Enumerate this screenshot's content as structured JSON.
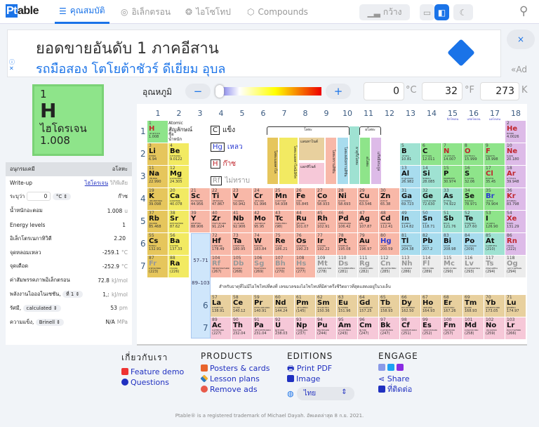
{
  "header": {
    "logo_a": "Pt",
    "logo_b": "able",
    "tabs": [
      {
        "label": "คุณสมบัติ",
        "icon": "list-icon"
      },
      {
        "label": "อิเล็กตรอน",
        "icon": "atom-icon"
      },
      {
        "label": "ไอโซโทป",
        "icon": "nucleus-icon"
      },
      {
        "label": "Compounds",
        "icon": "molecule-icon"
      }
    ],
    "wide_label": "กว้าง",
    "accent": "#1a73e8"
  },
  "ad": {
    "headline": "ยอดขายอันดับ 1 ภาคอีสาน",
    "subline": "รถมือสอง โตโยต้าชัวร์ ดีเยี่ยม อุบล",
    "close": "×",
    "label": "«Ad"
  },
  "selected": {
    "number": "1",
    "symbol": "H",
    "name": "ไฮโดรเจน",
    "mass": "1.008"
  },
  "temperature": {
    "label": "อุณหภูมิ",
    "minus": "−",
    "plus": "+",
    "celsius": "0",
    "celsius_unit": "°C",
    "fahrenheit": "32",
    "fahrenheit_unit": "°F",
    "kelvin": "273",
    "kelvin_unit": "K",
    "slider_fraction": 0.02
  },
  "properties": {
    "series_label": "อนุกรมเคมี",
    "series_value": "อโลหะ",
    "writeup_label": "Write-up",
    "writeup_link": "ไฮโดรเจน",
    "writeup_wiki": "วิกิพีเดีย",
    "state_label": "ระบุว่า",
    "state_temp": "0",
    "state_unit": "°C ⇕",
    "state_value": "ก๊าซ",
    "rows": [
      {
        "label": "น้ำหนักอะตอม",
        "value": "1.008",
        "unit": "u"
      },
      {
        "label": "Energy levels",
        "value": "1",
        "unit": ""
      },
      {
        "label": "อิเล็กโตรเนกาทิวิตี",
        "value": "2.20",
        "unit": ""
      },
      {
        "label": "จุดหลอมเหลว",
        "value": "-259.1",
        "unit": "°C"
      },
      {
        "label": "จุดเดือด",
        "value": "-252.9",
        "unit": "°C"
      },
      {
        "label": "ค่าสัมพรรคภาพอิเล็กตรอน",
        "value": "72.8",
        "unit": "kJ/mol"
      }
    ],
    "ion_label": "พลังงานไอออไนเซชัน,",
    "ion_select": "ที่ 1  ⇕",
    "ion_value": "1,:",
    "ion_unit": "kJ/mol",
    "radius_label": "รัศมี,",
    "radius_select": "calculated   ⇕",
    "radius_value": "53",
    "radius_unit": "pm",
    "hard_label": "ความแข็ง,",
    "hard_select": "Brinell ⇕",
    "hard_value": "N/A",
    "hard_unit": "MPa"
  },
  "table": {
    "groups": [
      "1",
      "2",
      "3",
      "4",
      "5",
      "6",
      "7",
      "8",
      "9",
      "10",
      "11",
      "12",
      "13",
      "14",
      "15",
      "16",
      "17",
      "18"
    ],
    "group_subtitles": {
      "15": "นิกโทเจน",
      "16": "แชลโคเจน",
      "17": "แฮโลเจน"
    },
    "periods": [
      "1",
      "2",
      "3",
      "4",
      "5",
      "6",
      "7"
    ],
    "f_periods": [
      "6",
      "7"
    ],
    "lan_range": "57–71",
    "act_range": "89–103",
    "key": {
      "atomic": "Atomic",
      "symbol": "สัญลักษณ์",
      "name": "ชื่อ",
      "weight": "น้ำหนัก"
    },
    "states": [
      {
        "sym": "C",
        "label": "แข็ง",
        "color": "#222"
      },
      {
        "sym": "Hg",
        "label": "เหลว",
        "color": "#2a3ad0"
      },
      {
        "sym": "H",
        "label": "ก๊าซ",
        "color": "#c0262d"
      },
      {
        "sym": "Rf",
        "label": "ไม่ทราบ",
        "color": "#999"
      }
    ],
    "metal_label": "โลหะ",
    "nonmetal_label": "อโลหะ",
    "categories": {
      "al": {
        "label": "โลหะแอลคาไล",
        "color": "#e6c65c"
      },
      "ae": {
        "label": "โลหะแอลคาไลน์เอิร์ท",
        "color": "#f2ea62"
      },
      "la": {
        "label": "แลนทาไนด์",
        "color": "#e8d09e"
      },
      "ac": {
        "label": "แอกทิไนด์",
        "color": "#f6c8d8"
      },
      "tm": {
        "label": "โลหะทรานสิชัน",
        "color": "#f8b8a8"
      },
      "pt": {
        "label": "โลหะหลังทรานสิชัน",
        "color": "#a8dcee"
      },
      "md": {
        "label": "ธาตุกึ่งโลหะ",
        "color": "#9fe2d2"
      },
      "nm": {
        "label": "อโลหะ",
        "color": "#8ee48a"
      },
      "ng": {
        "label": "แก๊สมีตระกูล",
        "color": "#ddbbe8"
      },
      "uk": {
        "label": "",
        "color": "#ececec"
      }
    },
    "note": "สำหรับธาตุที่ไม่มีไอโซโทปที่คงที่ เลขมวลของไอโซโทปที่มีค่าครึ่งชีวิตยาวที่สุดแสดงอยู่ในวงเล็บ",
    "elements": [
      [
        1,
        "H",
        "ไฮโดรเจน",
        "1.008",
        "nm",
        "g"
      ],
      [
        2,
        "He",
        "ฮีเลียม",
        "4.0026",
        "ng",
        "g"
      ],
      [
        3,
        "Li",
        "ลิเทียม",
        "6.94",
        "al",
        "s"
      ],
      [
        4,
        "Be",
        "เบริลเลียม",
        "9.0122",
        "ae",
        "s"
      ],
      [
        5,
        "B",
        "โบรอน",
        "10.81",
        "md",
        "s"
      ],
      [
        6,
        "C",
        "คาร์บอน",
        "12.011",
        "nm",
        "s"
      ],
      [
        7,
        "N",
        "ไนโตรเจน",
        "14.007",
        "nm",
        "g"
      ],
      [
        8,
        "O",
        "ออกซิเจน",
        "15.999",
        "nm",
        "g"
      ],
      [
        9,
        "F",
        "ฟลูออรีน",
        "18.998",
        "nm",
        "g"
      ],
      [
        10,
        "Ne",
        "นีออน",
        "20.180",
        "ng",
        "g"
      ],
      [
        11,
        "Na",
        "โซเดียม",
        "22.990",
        "al",
        "s"
      ],
      [
        12,
        "Mg",
        "แมกนีเซียม",
        "24.305",
        "ae",
        "s"
      ],
      [
        13,
        "Al",
        "อะลูมิเนียม",
        "26.982",
        "pt",
        "s"
      ],
      [
        14,
        "Si",
        "ซิลิคอน",
        "28.085",
        "md",
        "s"
      ],
      [
        15,
        "P",
        "ฟอสฟอรัส",
        "30.974",
        "nm",
        "s"
      ],
      [
        16,
        "S",
        "กำมะถัน",
        "32.06",
        "nm",
        "s"
      ],
      [
        17,
        "Cl",
        "คลอรีน",
        "35.45",
        "nm",
        "g"
      ],
      [
        18,
        "Ar",
        "อาร์กอน",
        "39.948",
        "ng",
        "g"
      ],
      [
        19,
        "K",
        "โพแทสเซียม",
        "39.098",
        "al",
        "s"
      ],
      [
        20,
        "Ca",
        "แคลเซียม",
        "40.078",
        "ae",
        "s"
      ],
      [
        21,
        "Sc",
        "สแกนเดียม",
        "44.956",
        "tm",
        "s"
      ],
      [
        22,
        "Ti",
        "ไทเทเนียม",
        "47.867",
        "tm",
        "s"
      ],
      [
        23,
        "V",
        "วาเนเดียม",
        "50.942",
        "tm",
        "s"
      ],
      [
        24,
        "Cr",
        "โครเมียม",
        "51.996",
        "tm",
        "s"
      ],
      [
        25,
        "Mn",
        "แมงกานีส",
        "54.938",
        "tm",
        "s"
      ],
      [
        26,
        "Fe",
        "เหล็ก",
        "55.845",
        "tm",
        "s"
      ],
      [
        27,
        "Co",
        "โคบอลต์",
        "58.933",
        "tm",
        "s"
      ],
      [
        28,
        "Ni",
        "นิกเกิล",
        "58.693",
        "tm",
        "s"
      ],
      [
        29,
        "Cu",
        "ทองแดง",
        "63.546",
        "tm",
        "s"
      ],
      [
        30,
        "Zn",
        "สังกะสี",
        "65.38",
        "tm",
        "s"
      ],
      [
        31,
        "Ga",
        "แกลเลียม",
        "69.723",
        "pt",
        "s"
      ],
      [
        32,
        "Ge",
        "เจอร์เมเนียม",
        "72.630",
        "md",
        "s"
      ],
      [
        33,
        "As",
        "สารหนู",
        "74.922",
        "md",
        "s"
      ],
      [
        34,
        "Se",
        "ซีลีเนียม",
        "78.971",
        "nm",
        "s"
      ],
      [
        35,
        "Br",
        "โบรมีน",
        "79.904",
        "nm",
        "l"
      ],
      [
        36,
        "Kr",
        "คริปทอน",
        "83.798",
        "ng",
        "g"
      ],
      [
        37,
        "Rb",
        "รูบิเดียม",
        "85.468",
        "al",
        "s"
      ],
      [
        38,
        "Sr",
        "สตรอนเซียม",
        "87.62",
        "ae",
        "s"
      ],
      [
        39,
        "Y",
        "อิตเทรียม",
        "88.906",
        "tm",
        "s"
      ],
      [
        40,
        "Zr",
        "เซอร์โคเนียม",
        "91.224",
        "tm",
        "s"
      ],
      [
        41,
        "Nb",
        "ไนโอเบียม",
        "92.906",
        "tm",
        "s"
      ],
      [
        42,
        "Mo",
        "โมลิบดีนัม",
        "95.95",
        "tm",
        "s"
      ],
      [
        43,
        "Tc",
        "เทคนีเชียม",
        "(98)",
        "tm",
        "s"
      ],
      [
        44,
        "Ru",
        "รูทีเนียม",
        "101.07",
        "tm",
        "s"
      ],
      [
        45,
        "Rh",
        "โรเดียม",
        "102.91",
        "tm",
        "s"
      ],
      [
        46,
        "Pd",
        "แพลเลเดียม",
        "106.42",
        "tm",
        "s"
      ],
      [
        47,
        "Ag",
        "เงิน",
        "107.87",
        "tm",
        "s"
      ],
      [
        48,
        "Cd",
        "แคดเมียม",
        "112.41",
        "tm",
        "s"
      ],
      [
        49,
        "In",
        "อินเดียม",
        "114.82",
        "pt",
        "s"
      ],
      [
        50,
        "Sn",
        "ดีบุก",
        "118.71",
        "pt",
        "s"
      ],
      [
        51,
        "Sb",
        "พลวง",
        "121.76",
        "md",
        "s"
      ],
      [
        52,
        "Te",
        "เทลลูเรียม",
        "127.60",
        "md",
        "s"
      ],
      [
        53,
        "I",
        "ไอโอดีน",
        "126.90",
        "nm",
        "s"
      ],
      [
        54,
        "Xe",
        "ซีนอน",
        "131.29",
        "ng",
        "g"
      ],
      [
        55,
        "Cs",
        "ซีเซียม",
        "132.91",
        "al",
        "s"
      ],
      [
        56,
        "Ba",
        "แบเรียม",
        "137.33",
        "ae",
        "s"
      ],
      [
        57,
        "La",
        "แลนทานัม",
        "138.91",
        "la",
        "s"
      ],
      [
        58,
        "Ce",
        "ซีเรียม",
        "140.12",
        "la",
        "s"
      ],
      [
        59,
        "Pr",
        "เพรซีโอดิเมียม",
        "140.91",
        "la",
        "s"
      ],
      [
        60,
        "Nd",
        "นีโอดิเมียม",
        "144.24",
        "la",
        "s"
      ],
      [
        61,
        "Pm",
        "โพรมีเทียม",
        "(145)",
        "la",
        "s"
      ],
      [
        62,
        "Sm",
        "ซาแมเรียม",
        "150.36",
        "la",
        "s"
      ],
      [
        63,
        "Eu",
        "ยูโรเพียม",
        "151.96",
        "la",
        "s"
      ],
      [
        64,
        "Gd",
        "แกโดลิเนียม",
        "157.25",
        "la",
        "s"
      ],
      [
        65,
        "Tb",
        "เทอร์เบียม",
        "158.93",
        "la",
        "s"
      ],
      [
        66,
        "Dy",
        "ดิสโพรเซียม",
        "162.50",
        "la",
        "s"
      ],
      [
        67,
        "Ho",
        "โฮลเมียม",
        "164.93",
        "la",
        "s"
      ],
      [
        68,
        "Er",
        "เออร์เบียม",
        "167.26",
        "la",
        "s"
      ],
      [
        69,
        "Tm",
        "ทูเลียม",
        "168.93",
        "la",
        "s"
      ],
      [
        70,
        "Yb",
        "อิตเทอร์เบียม",
        "173.05",
        "la",
        "s"
      ],
      [
        71,
        "Lu",
        "ลูทีเทียม",
        "174.97",
        "la",
        "s"
      ],
      [
        72,
        "Hf",
        "แฮฟเนียม",
        "178.49",
        "tm",
        "s"
      ],
      [
        73,
        "Ta",
        "แทนทาลัม",
        "180.95",
        "tm",
        "s"
      ],
      [
        74,
        "W",
        "ทังสเตน",
        "183.84",
        "tm",
        "s"
      ],
      [
        75,
        "Re",
        "รีเนียม",
        "186.21",
        "tm",
        "s"
      ],
      [
        76,
        "Os",
        "ออสเมียม",
        "190.23",
        "tm",
        "s"
      ],
      [
        77,
        "Ir",
        "อิริเดียม",
        "192.22",
        "tm",
        "s"
      ],
      [
        78,
        "Pt",
        "แพลทินัม",
        "195.08",
        "tm",
        "s"
      ],
      [
        79,
        "Au",
        "ทองคำ",
        "196.97",
        "tm",
        "s"
      ],
      [
        80,
        "Hg",
        "ปรอท",
        "200.59",
        "tm",
        "l"
      ],
      [
        81,
        "Tl",
        "แทลเลียม",
        "204.38",
        "pt",
        "s"
      ],
      [
        82,
        "Pb",
        "ตะกั่ว",
        "207.2",
        "pt",
        "s"
      ],
      [
        83,
        "Bi",
        "บิสมัท",
        "208.98",
        "pt",
        "s"
      ],
      [
        84,
        "Po",
        "พอโลเนียม",
        "(209)",
        "pt",
        "s"
      ],
      [
        85,
        "At",
        "แอสทาทีน",
        "(210)",
        "md",
        "s"
      ],
      [
        86,
        "Rn",
        "เรดอน",
        "(222)",
        "ng",
        "g"
      ],
      [
        87,
        "Fr",
        "แฟรนเซียม",
        "(223)",
        "al",
        "u"
      ],
      [
        88,
        "Ra",
        "เรเดียม",
        "(226)",
        "ae",
        "s"
      ],
      [
        89,
        "Ac",
        "แอกทิเนียม",
        "(227)",
        "ac",
        "s"
      ],
      [
        90,
        "Th",
        "ทอเรียม",
        "232.04",
        "ac",
        "s"
      ],
      [
        91,
        "Pa",
        "โพรแทกทิเนียม",
        "231.04",
        "ac",
        "s"
      ],
      [
        92,
        "U",
        "ยูเรเนียม",
        "238.03",
        "ac",
        "s"
      ],
      [
        93,
        "Np",
        "เนปทูเนียม",
        "(237)",
        "ac",
        "s"
      ],
      [
        94,
        "Pu",
        "พลูโทเนียม",
        "(244)",
        "ac",
        "s"
      ],
      [
        95,
        "Am",
        "อะเมริเซียม",
        "(243)",
        "ac",
        "s"
      ],
      [
        96,
        "Cm",
        "คูเรียม",
        "(247)",
        "ac",
        "s"
      ],
      [
        97,
        "Bk",
        "เบอร์คีเลียม",
        "(247)",
        "ac",
        "s"
      ],
      [
        98,
        "Cf",
        "แคลิฟอร์เนียม",
        "(251)",
        "ac",
        "s"
      ],
      [
        99,
        "Es",
        "ไอน์สไตเนียม",
        "(252)",
        "ac",
        "s"
      ],
      [
        100,
        "Fm",
        "เฟอร์เมียม",
        "(257)",
        "ac",
        "s"
      ],
      [
        101,
        "Md",
        "เมนเดลีเวียม",
        "(258)",
        "ac",
        "s"
      ],
      [
        102,
        "No",
        "โนเบเลียม",
        "(259)",
        "ac",
        "s"
      ],
      [
        103,
        "Lr",
        "ลอว์เรนเซียม",
        "(266)",
        "ac",
        "s"
      ],
      [
        104,
        "Rf",
        "รัทเทอร์ฟอร์เดียม",
        "(267)",
        "tm",
        "u"
      ],
      [
        105,
        "Db",
        "ดุบเนียม",
        "(268)",
        "tm",
        "u"
      ],
      [
        106,
        "Sg",
        "ซีบอร์เกียม",
        "(269)",
        "tm",
        "u"
      ],
      [
        107,
        "Bh",
        "โบห์เรียม",
        "(270)",
        "tm",
        "u"
      ],
      [
        108,
        "Hs",
        "ฮัสเซียม",
        "(277)",
        "tm",
        "u"
      ],
      [
        109,
        "Mt",
        "ไมต์เนอเรียม",
        "(278)",
        "uk",
        "u"
      ],
      [
        110,
        "Ds",
        "ดาร์มสตัดเทียม",
        "(281)",
        "uk",
        "u"
      ],
      [
        111,
        "Rg",
        "เรินต์เกเนียม",
        "(282)",
        "uk",
        "u"
      ],
      [
        112,
        "Cn",
        "โคเปอร์นิเซียม",
        "(285)",
        "uk",
        "u"
      ],
      [
        113,
        "Nh",
        "นิโฮเนียม",
        "(286)",
        "uk",
        "u"
      ],
      [
        114,
        "Fl",
        "ฟลีโรเวียม",
        "(289)",
        "uk",
        "u"
      ],
      [
        115,
        "Mc",
        "มอสโกเวียม",
        "(290)",
        "uk",
        "u"
      ],
      [
        116,
        "Lv",
        "ลิเวอร์มอเรียม",
        "(293)",
        "uk",
        "u"
      ],
      [
        117,
        "Ts",
        "เทนเนสซีน",
        "(294)",
        "uk",
        "u"
      ],
      [
        118,
        "Og",
        "โอกาเนสซอน",
        "(294)",
        "uk",
        "u"
      ]
    ]
  },
  "footer": {
    "about": {
      "title": "เกี่ยวกับเรา",
      "links": [
        "Feature demo",
        "Questions"
      ]
    },
    "products": {
      "title": "PRODUCTS",
      "links": [
        "Posters & cards",
        "Lesson plans",
        "Remove ads"
      ]
    },
    "editions": {
      "title": "EDITIONS",
      "links": [
        "Print PDF",
        "Image"
      ],
      "language": "ไทย"
    },
    "engage": {
      "title": "ENGAGE",
      "links": [
        "Share",
        "ที่ติดต่อ"
      ]
    },
    "copyright": "Ptable® is a registered trademark of Michael Dayah. อัพเดตล่าสุด 8 ก.ย. 2021."
  }
}
